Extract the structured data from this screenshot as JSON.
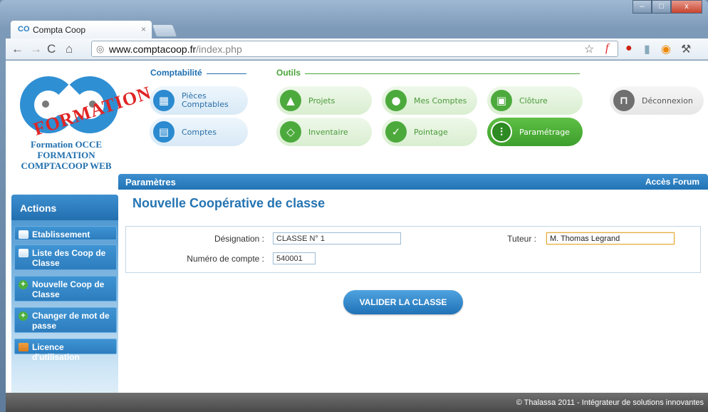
{
  "browser": {
    "tab_logo": "CO",
    "tab_title": "Compta Coop",
    "tab_close": "×",
    "url_host": "www.comptacoop.fr",
    "url_path": "/index.php",
    "window_min": "–",
    "window_max": "□",
    "window_close": "x"
  },
  "header": {
    "logo_stamp": "FORMATION",
    "org_name": "Formation OCCE FORMATION COMPTACOOP WEB",
    "comptabilite_label": "Comptabilité",
    "outils_label": "Outils",
    "buttons": {
      "pieces": "Pièces Comptables",
      "comptes": "Comptes",
      "projets": "Projets",
      "mes_comptes": "Mes Comptes",
      "cloture": "Clôture",
      "inventaire": "Inventaire",
      "pointage": "Pointage",
      "parametrage": "Paramétrage",
      "deconnexion": "Déconnexion"
    }
  },
  "bar": {
    "title": "Paramètres",
    "forum_link": "Accès Forum"
  },
  "sidebar": {
    "title": "Actions",
    "items": [
      {
        "label": "Etablissement"
      },
      {
        "label": "Liste des Coop de Classe"
      },
      {
        "label": "Nouvelle Coop de Classe"
      },
      {
        "label": "Changer de mot de passe"
      },
      {
        "label": "Licence d'utilisation"
      }
    ]
  },
  "main": {
    "title": "Nouvelle Coopérative de classe",
    "designation_label": "Désignation :",
    "designation_value": "CLASSE N° 1",
    "tuteur_label": "Tuteur :",
    "tuteur_value": "M. Thomas Legrand",
    "compte_label": "Numéro de compte :",
    "compte_value": "540001",
    "validate_label": "VALIDER LA CLASSE"
  },
  "footer": {
    "text": "© Thalassa 2011 - Intégrateur de solutions innovantes"
  }
}
